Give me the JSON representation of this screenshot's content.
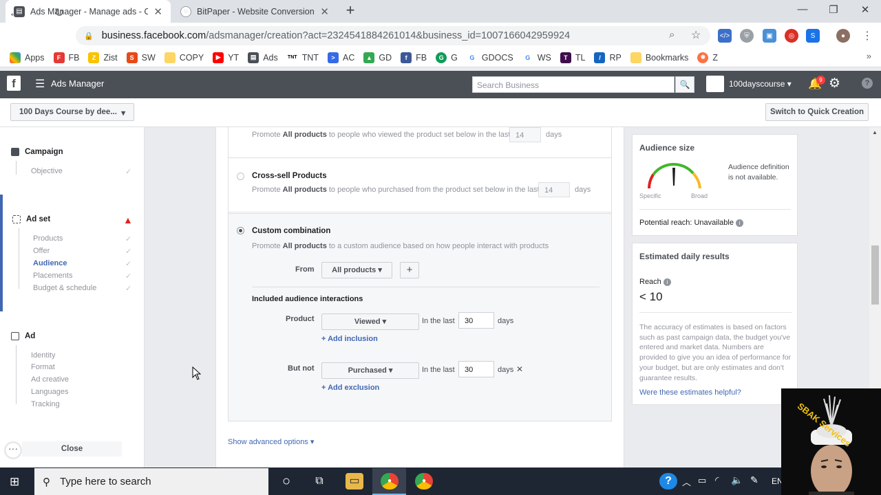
{
  "browser": {
    "tabs": [
      {
        "title": "Ads Manager - Manage ads - Ca",
        "active": true
      },
      {
        "title": "BitPaper - Website Conversions A",
        "active": false
      }
    ],
    "url_host": "business.facebook.com",
    "url_path": "/adsmanager/creation?act=2324541884261014&business_id=1007166042959924",
    "bookmarks": [
      "Apps",
      "FB",
      "Zist",
      "SW",
      "COPY",
      "YT",
      "Ads",
      "TNT",
      "AC",
      "GD",
      "FB",
      "G",
      "GDOCS",
      "WS",
      "TL",
      "RP",
      "Bookmarks",
      "Z"
    ],
    "bookmarks_more": "»"
  },
  "fb": {
    "app_name": "Ads Manager",
    "search_placeholder": "Search Business",
    "account_name": "100dayscourse",
    "notification_count": "9",
    "campaign_selector": "100 Days Course by dee...",
    "quick_creation": "Switch to Quick Creation"
  },
  "leftnav": {
    "campaign": {
      "title": "Campaign",
      "items": [
        "Objective"
      ]
    },
    "adset": {
      "title": "Ad set",
      "items": [
        "Products",
        "Offer",
        "Audience",
        "Placements",
        "Budget & schedule"
      ],
      "current": "Audience"
    },
    "ad": {
      "title": "Ad",
      "items": [
        "Identity",
        "Format",
        "Ad creative",
        "Languages",
        "Tracking"
      ]
    },
    "close": "Close"
  },
  "options": {
    "upsell": {
      "pre": "Promote",
      "bold": "All products",
      "post": "to people who viewed the product set below in the last",
      "days_value": "14",
      "days_unit": "days"
    },
    "crosssell": {
      "title": "Cross-sell Products",
      "pre": "Promote",
      "bold": "All products",
      "post": "to people who purchased from the product set below in the last",
      "days_value": "14",
      "days_unit": "days"
    },
    "custom": {
      "title": "Custom combination",
      "pre": "Promote",
      "bold": "All products",
      "post": "to a custom audience based on how people interact with products"
    }
  },
  "custom_form": {
    "from_label": "From",
    "from_value": "All products",
    "add_label": "+",
    "section_title": "Included audience interactions",
    "product_label": "Product",
    "product_event": "Viewed",
    "in_the_last": "In the last",
    "product_days": "30",
    "days": "days",
    "add_inclusion": "+ Add inclusion",
    "butnot_label": "But not",
    "butnot_event": "Purchased",
    "butnot_days": "30",
    "add_exclusion": "+ Add exclusion",
    "advanced": "Show advanced options"
  },
  "audience_size": {
    "title": "Audience size",
    "definition": "Audience definition is not available.",
    "specific": "Specific",
    "broad": "Broad",
    "potential_reach": "Potential reach: Unavailable"
  },
  "estimates": {
    "title": "Estimated daily results",
    "reach_label": "Reach",
    "reach_value": "< 10",
    "disclaimer": "The accuracy of estimates is based on factors such as past campaign data, the budget you've entered and market data. Numbers are provided to give you an idea of performance for your budget, but are only estimates and don't guarantee results.",
    "helpful": "Were these estimates helpful?"
  },
  "taskbar": {
    "search_placeholder": "Type here to search",
    "lang": "EN"
  },
  "overlay": {
    "text": "SBAK Services"
  }
}
